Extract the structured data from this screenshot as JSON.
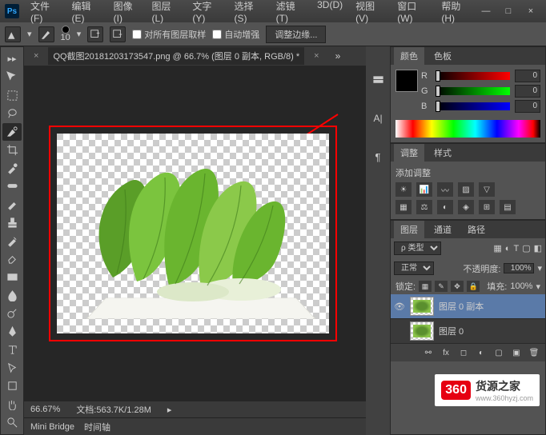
{
  "menubar": {
    "items": [
      "文件(F)",
      "编辑(E)",
      "图像(I)",
      "图层(L)",
      "文字(Y)",
      "选择(S)",
      "滤镜(T)",
      "3D(D)",
      "视图(V)",
      "窗口(W)",
      "帮助(H)"
    ]
  },
  "window": {
    "minimize": "—",
    "maximize": "□",
    "close": "×"
  },
  "optbar": {
    "brush_size": "10",
    "chk1": "对所有图层取样",
    "chk2": "自动增强",
    "refine": "调整边缘..."
  },
  "doc": {
    "tab": "QQ截图20181203173547.png @ 66.7% (图层 0 副本, RGB/8) *"
  },
  "status": {
    "zoom": "66.67%",
    "docinfo": "文档:563.7K/1.28M"
  },
  "bottom": {
    "mini": "Mini Bridge",
    "timeline": "时间轴"
  },
  "panels": {
    "color": {
      "tab_color": "颜色",
      "tab_swatch": "色板",
      "r": "R",
      "g": "G",
      "b": "B",
      "rv": "0",
      "gv": "0",
      "bv": "0"
    },
    "adjust": {
      "tab_adj": "调整",
      "tab_style": "样式",
      "title": "添加调整"
    },
    "layers": {
      "tab_layer": "图层",
      "tab_channel": "通道",
      "tab_path": "路径",
      "kind": "ρ 类型",
      "blend": "正常",
      "opacity_lbl": "不透明度:",
      "opacity": "100%",
      "fill_lbl": "填充:",
      "fill": "100%",
      "lock_lbl": "锁定:",
      "layer1": "图层 0 副本",
      "layer2": "图层 0"
    }
  },
  "watermark": {
    "logo": "360",
    "text": "货源之家",
    "url": "www.360hyzj.com"
  }
}
